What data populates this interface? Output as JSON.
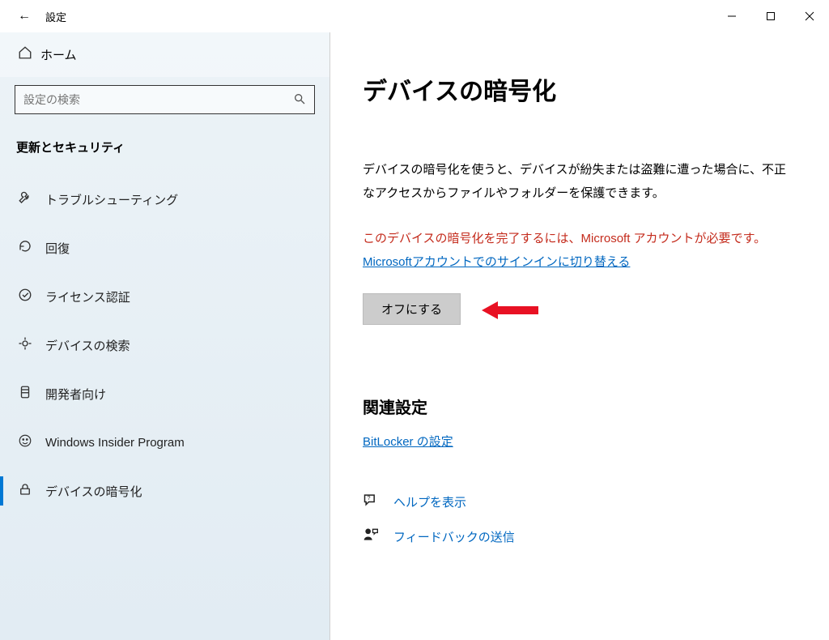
{
  "titlebar": {
    "back": "←",
    "title": "設定"
  },
  "sidebar": {
    "home": "ホーム",
    "search_placeholder": "設定の検索",
    "category": "更新とセキュリティ",
    "items": [
      {
        "icon": "wrench-icon",
        "glyph": "🛠",
        "label": "トラブルシューティング"
      },
      {
        "icon": "recovery-icon",
        "glyph": "⟳",
        "label": "回復"
      },
      {
        "icon": "check-icon",
        "glyph": "✔",
        "label": "ライセンス認証"
      },
      {
        "icon": "location-icon",
        "glyph": "⌖",
        "label": "デバイスの検索"
      },
      {
        "icon": "developer-icon",
        "glyph": "§",
        "label": "開発者向け"
      },
      {
        "icon": "insider-icon",
        "glyph": "☻",
        "label": "Windows Insider Program"
      },
      {
        "icon": "lock-icon",
        "glyph": "🔒",
        "label": "デバイスの暗号化"
      }
    ]
  },
  "main": {
    "heading": "デバイスの暗号化",
    "description": "デバイスの暗号化を使うと、デバイスが紛失または盗難に遭った場合に、不正なアクセスからファイルやフォルダーを保護できます。",
    "error_text": "このデバイスの暗号化を完了するには、Microsoft アカウントが必要です。",
    "switch_link": "Microsoftアカウントでのサインインに切り替える",
    "turn_off": "オフにする",
    "related_heading": "関連設定",
    "bitlocker_link": "BitLocker の設定",
    "help": "ヘルプを表示",
    "feedback": "フィードバックの送信"
  }
}
